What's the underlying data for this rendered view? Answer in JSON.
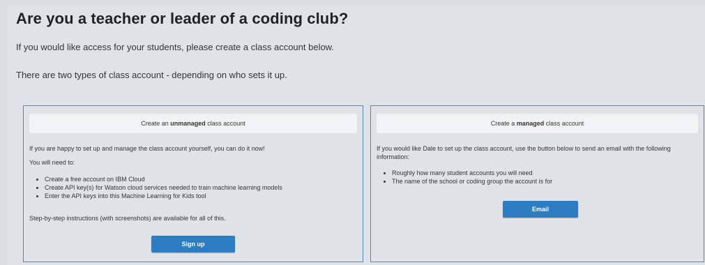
{
  "heading": "Are you a teacher or leader of a coding club?",
  "intro_line1": "If you would like access for your students, please create a class account below.",
  "intro_line2": "There are two types of class account - depending on who sets it up.",
  "unmanaged": {
    "title_prefix": "Create an ",
    "title_bold": "unmanaged",
    "title_suffix": " class account",
    "para1": "If you are happy to set up and manage the class account yourself, you can do it now!",
    "para2": "You will need to:",
    "items": [
      "Create a free account on IBM Cloud",
      "Create API key(s) for Watson cloud services needed to train machine learning models",
      "Enter the API keys into this Machine Learning for Kids tool"
    ],
    "para3": "Step-by-step instructions (with screenshots) are available for all of this.",
    "button_label": "Sign up"
  },
  "managed": {
    "title_prefix": "Create a ",
    "title_bold": "managed",
    "title_suffix": " class account",
    "para1": "If you would like Dale to set up the class account, use the button below to send an email with the following information:",
    "items": [
      "Roughly how many student accounts you will need",
      "The name of the school or coding group the account is for"
    ],
    "button_label": "Email"
  }
}
